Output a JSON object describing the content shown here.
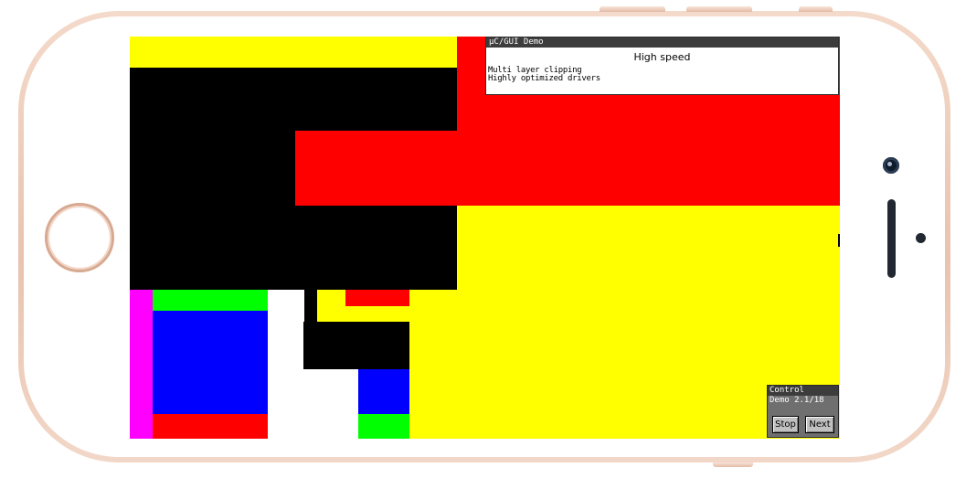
{
  "device": {
    "frame_color": "#efcfbe",
    "screen_background": "#000000"
  },
  "demo_window": {
    "title": "µC/GUI Demo",
    "heading": "High speed",
    "lines": [
      "Multi layer clipping",
      "Highly optimized drivers"
    ]
  },
  "control_window": {
    "title": "Control",
    "status": "Demo 2.1/18",
    "stop_label": "Stop",
    "next_label": "Next"
  },
  "colors": {
    "yellow": "#ffff00",
    "red": "#ff0000",
    "black": "#000000",
    "green": "#00ff00",
    "blue": "#0000ff",
    "magenta": "#ff00ff",
    "white": "#ffffff"
  }
}
